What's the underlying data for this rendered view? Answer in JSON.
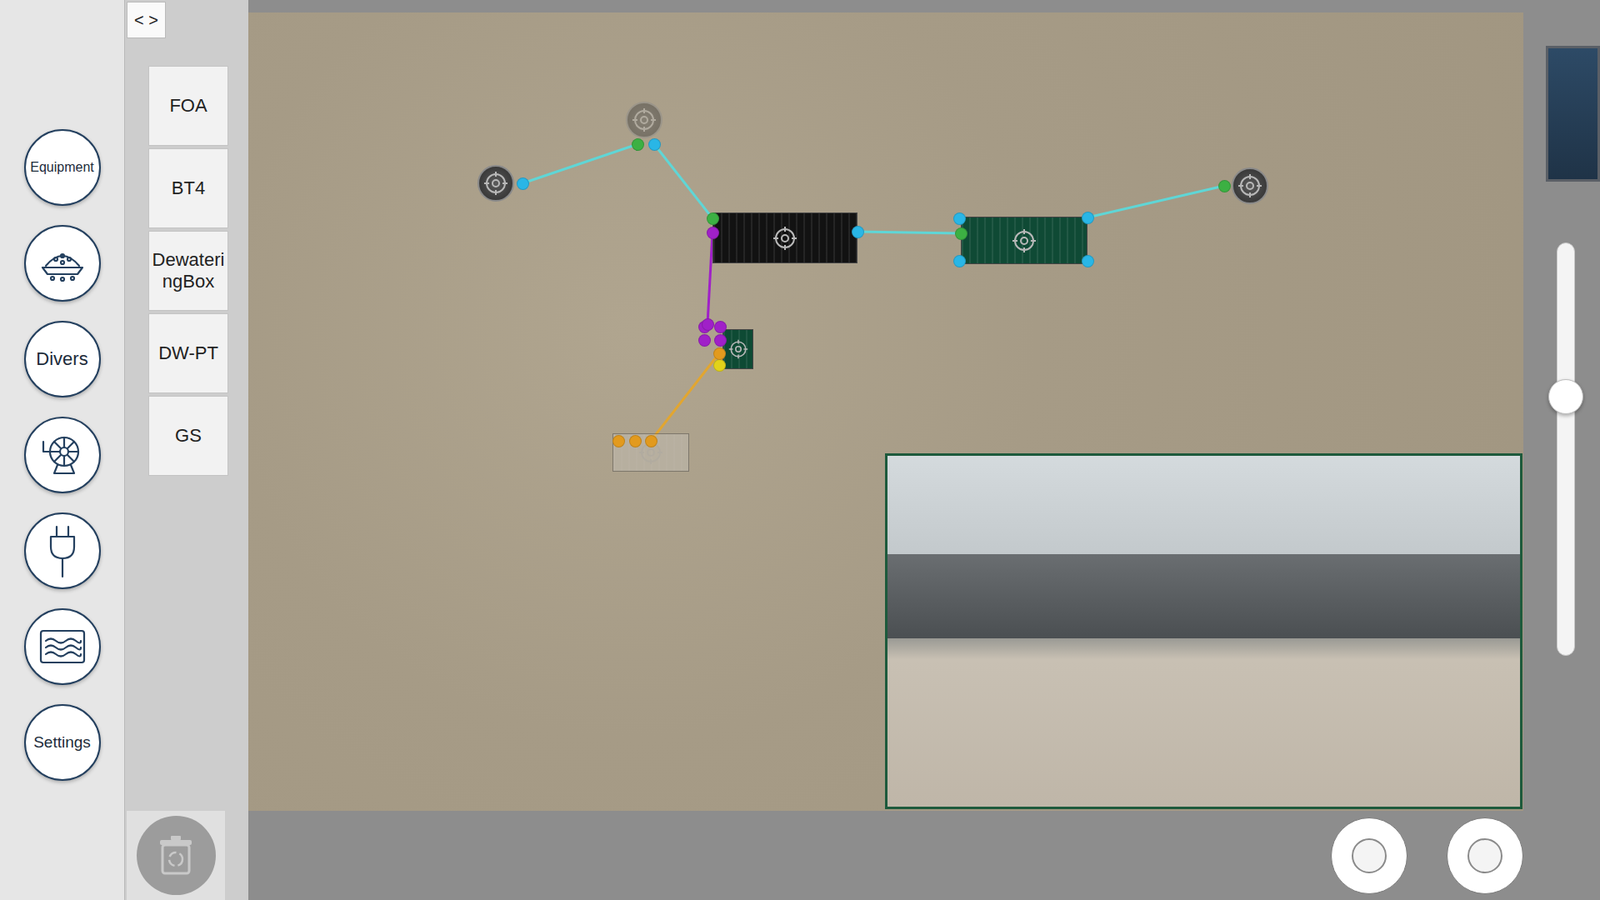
{
  "sidebar": {
    "items": [
      {
        "kind": "text",
        "label": "Equipment"
      },
      {
        "kind": "icon"
      },
      {
        "kind": "text",
        "label": "Divers"
      },
      {
        "kind": "icon"
      },
      {
        "kind": "icon"
      },
      {
        "kind": "icon"
      },
      {
        "kind": "text",
        "label": "Settings"
      }
    ]
  },
  "palette": {
    "toggle": "< >",
    "items": [
      "FOA",
      "BT4",
      "DewateringBox",
      "DW-PT",
      "GS"
    ]
  },
  "canvas": {
    "nodes": [
      {
        "kind": "round",
        "faded": false,
        "color": "#3a3a3a",
        "ports": []
      },
      {
        "kind": "round",
        "faded": true,
        "color": "#3a3a3a",
        "ports": []
      },
      {
        "kind": "rect",
        "faded": false,
        "color": "#121212",
        "ports": []
      },
      {
        "kind": "rect",
        "faded": false,
        "color": "#0f4a35",
        "ports": [
          "#29b6e6",
          "#29b6e6",
          "#29b6e6"
        ]
      },
      {
        "kind": "round",
        "faded": false,
        "color": "#3a3a3a",
        "ports": []
      },
      {
        "kind": "rect",
        "faded": false,
        "color": "#0e4a34",
        "ports": [
          "#a020c8",
          "#a020c8",
          "#a020c8",
          "#a020c8",
          "#e2d21a"
        ]
      },
      {
        "kind": "rect",
        "faded": true,
        "color": "#c4c0b8",
        "ports": [
          "#e29a1e",
          "#e29a1e"
        ]
      }
    ],
    "links": [
      {
        "color": "#5fd6d6",
        "end_colors": [
          "#29b6e6",
          "#3cb043"
        ]
      },
      {
        "color": "#5fd6d6",
        "end_colors": [
          "#29b6e6",
          "#3cb043"
        ]
      },
      {
        "color": "#5fd6d6",
        "end_colors": [
          "#29b6e6",
          "#3cb043"
        ]
      },
      {
        "color": "#5fd6d6",
        "end_colors": [
          "#29b6e6",
          "#3cb043"
        ]
      },
      {
        "color": "#a020c8",
        "end_colors": [
          "#a020c8",
          "#a020c8"
        ]
      },
      {
        "color": "#e2a630",
        "end_colors": [
          "#e29a1e",
          "#e29a1e"
        ]
      }
    ]
  },
  "zoom_slider": {
    "level": 0.63
  }
}
